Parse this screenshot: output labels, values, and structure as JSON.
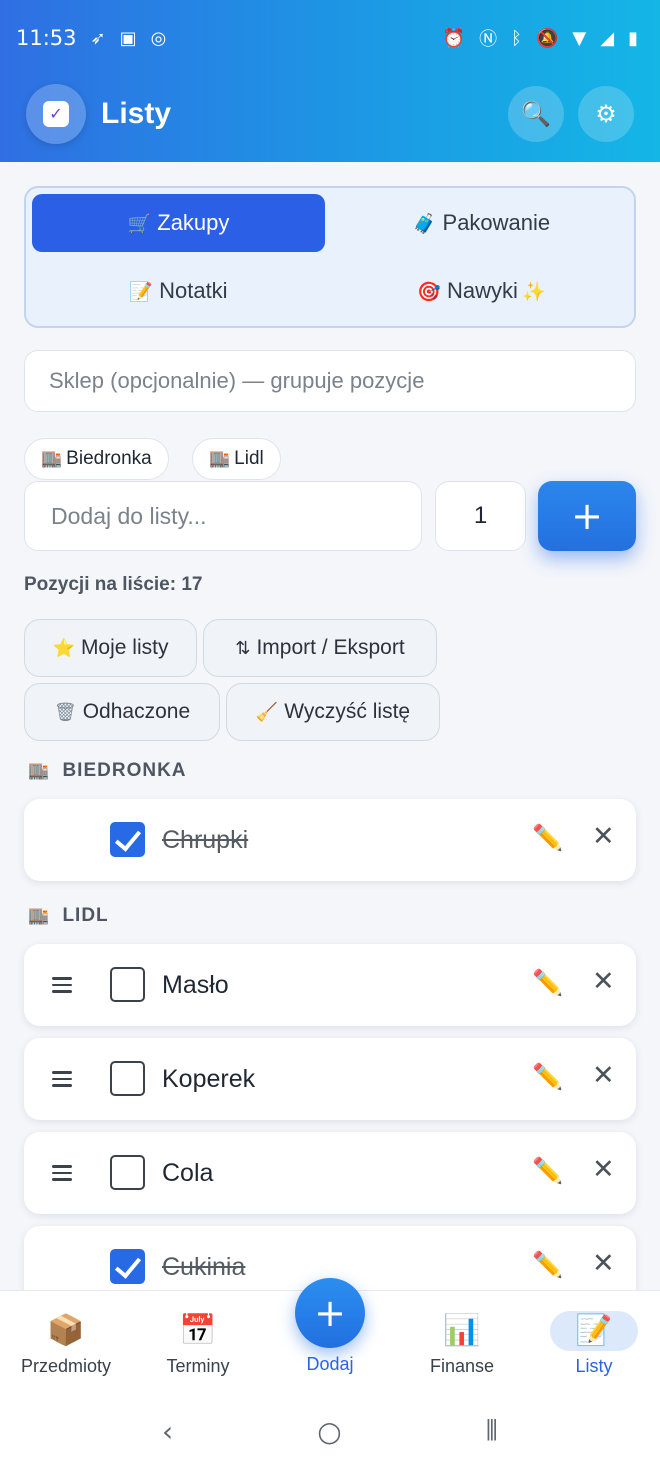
{
  "status_bar": {
    "time": "11:53",
    "left_icons": [
      "signal-app-icon",
      "message-app-icon",
      "whatsapp-icon"
    ],
    "right_icons": [
      "alarm-icon",
      "nfc-icon",
      "bluetooth-icon",
      "mute-icon",
      "wifi-icon",
      "cell-signal-icon",
      "battery-icon"
    ]
  },
  "app_bar": {
    "title": "Listy",
    "home_icon": "home-check-icon",
    "search_icon": "search-icon",
    "settings_icon": "gear-icon"
  },
  "tabs": [
    {
      "emoji": "🛒",
      "label": "Zakupy",
      "active": true
    },
    {
      "emoji": "🧳",
      "label": "Pakowanie",
      "active": false
    },
    {
      "emoji": "📝",
      "label": "Notatki",
      "active": false
    },
    {
      "emoji": "🎯",
      "label": "Nawyki",
      "suffix": "✨",
      "active": false
    }
  ],
  "shop_input": {
    "placeholder": "Sklep (opcjonalnie) — grupuje pozycje"
  },
  "shop_chips": [
    {
      "emoji": "🏬",
      "label": "Biedronka"
    },
    {
      "emoji": "🏬",
      "label": "Lidl"
    }
  ],
  "add_item": {
    "placeholder": "Dodaj do listy...",
    "quantity": "1",
    "add_symbol": "+"
  },
  "item_count_label": "Pozycji na liście: 17",
  "actions": [
    {
      "emoji": "⭐",
      "label": "Moje listy"
    },
    {
      "emoji": "⇅",
      "label": "Import / Eksport"
    },
    {
      "emoji": "🗑",
      "label": "Odhaczone"
    },
    {
      "emoji": "🧹",
      "label": "Wyczyść listę"
    }
  ],
  "groups": [
    {
      "emoji": "🏬",
      "title": "BIEDRONKA",
      "items": [
        {
          "label": "Chrupki",
          "checked": true
        }
      ]
    },
    {
      "emoji": "🏬",
      "title": "LIDL",
      "items": [
        {
          "label": "Masło",
          "checked": false
        },
        {
          "label": "Koperek",
          "checked": false
        },
        {
          "label": "Cola",
          "checked": false
        },
        {
          "label": "Cukinia",
          "checked": true
        }
      ]
    }
  ],
  "item_icons": {
    "edit": "✏️",
    "delete": "✕"
  },
  "bottom_nav": [
    {
      "emoji": "📦",
      "label": "Przedmioty"
    },
    {
      "emoji": "📅",
      "label": "Terminy"
    },
    {
      "emoji": "+",
      "label": "Dodaj"
    },
    {
      "emoji": "📊",
      "label": "Finanse"
    },
    {
      "emoji": "📝",
      "label": "Listy"
    }
  ],
  "system_nav": {
    "back": "‹",
    "home": "○",
    "recents": "⦀"
  },
  "colors": {
    "accent": "#2b5fe6",
    "header_start": "#2f6fe3",
    "header_end": "#14b6e6"
  }
}
